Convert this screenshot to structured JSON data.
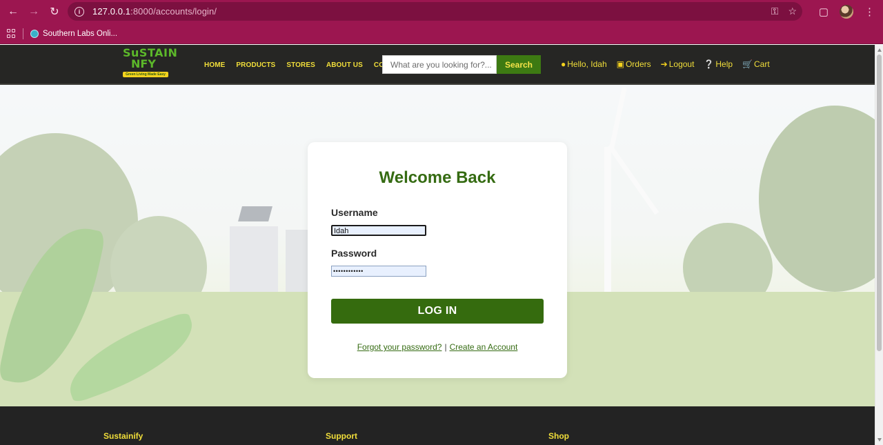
{
  "browser": {
    "url_host": "127.0.0.1",
    "url_rest": ":8000/accounts/login/",
    "bookmark_label": "Southern Labs Onli..."
  },
  "site": {
    "logo": {
      "line1": "SuSTAIN",
      "line2": "NFY",
      "tagline": "Green Living Made Easy"
    },
    "nav_links": [
      "HOME",
      "PRODUCTS",
      "STORES",
      "ABOUT US",
      "CONTACT"
    ],
    "search": {
      "placeholder": "What are you looking for?...",
      "button": "Search"
    },
    "user_menu": {
      "greeting": "Hello, Idah",
      "orders": "Orders",
      "logout": "Logout",
      "help": "Help",
      "cart": "Cart"
    }
  },
  "login": {
    "title": "Welcome Back",
    "username_label": "Username",
    "username_value": "Idah",
    "password_label": "Password",
    "password_value": "••••••••••••",
    "submit": "LOG IN",
    "forgot": "Forgot your password?",
    "separator": "|",
    "create": "Create an Account"
  },
  "footer": {
    "col1": "Sustainify",
    "col2": "Support",
    "col3": "Shop"
  },
  "colors": {
    "browser_chrome": "#9c1650",
    "nav_bg": "#262624",
    "nav_text": "#f2df3a",
    "brand_green": "#356b12",
    "footer_bg": "#232323"
  }
}
